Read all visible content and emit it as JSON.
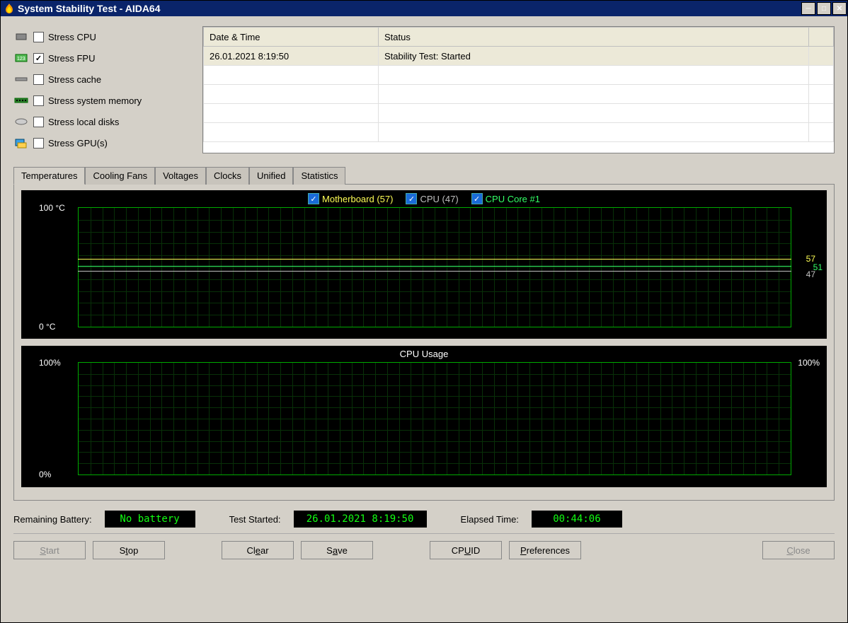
{
  "window": {
    "title": "System Stability Test - AIDA64"
  },
  "stress": {
    "items": [
      {
        "label": "Stress CPU",
        "checked": false
      },
      {
        "label": "Stress FPU",
        "checked": true
      },
      {
        "label": "Stress cache",
        "checked": false
      },
      {
        "label": "Stress system memory",
        "checked": false
      },
      {
        "label": "Stress local disks",
        "checked": false
      },
      {
        "label": "Stress GPU(s)",
        "checked": false
      }
    ]
  },
  "log": {
    "cols": [
      "Date & Time",
      "Status"
    ],
    "rows": [
      {
        "dt": "26.01.2021 8:19:50",
        "status": "Stability Test: Started"
      }
    ]
  },
  "tabs": [
    "Temperatures",
    "Cooling Fans",
    "Voltages",
    "Clocks",
    "Unified",
    "Statistics"
  ],
  "active_tab": 0,
  "chart_data": [
    {
      "type": "line",
      "title": "",
      "ylabel": "°C",
      "ylim": [
        0,
        100
      ],
      "y_ticks": [
        "100 °C",
        "0 °C"
      ],
      "legend": [
        {
          "name": "Motherboard (57)",
          "color": "#ffff55",
          "checked": true,
          "current": 57
        },
        {
          "name": "CPU (47)",
          "color": "#c0c0c0",
          "checked": true,
          "current": 47
        },
        {
          "name": "CPU Core #1",
          "color": "#33ff66",
          "checked": true,
          "current": 51
        }
      ],
      "series": [
        {
          "name": "Motherboard",
          "value_approx": 57
        },
        {
          "name": "CPU",
          "value_approx": 47
        },
        {
          "name": "CPU Core #1",
          "value_approx": 51
        }
      ],
      "right_labels": [
        "57",
        "51",
        "47"
      ]
    },
    {
      "type": "line",
      "title": "CPU Usage",
      "ylabel": "%",
      "ylim": [
        0,
        100
      ],
      "y_ticks_left": [
        "100%",
        "0%"
      ],
      "y_ticks_right": [
        "100%"
      ],
      "series": [
        {
          "name": "CPU Usage",
          "value_approx": 0
        }
      ]
    }
  ],
  "status": {
    "battery_label": "Remaining Battery:",
    "battery_value": "No battery",
    "started_label": "Test Started:",
    "started_value": "26.01.2021 8:19:50",
    "elapsed_label": "Elapsed Time:",
    "elapsed_value": "00:44:06"
  },
  "buttons": {
    "start": "Start",
    "stop": "Stop",
    "clear": "Clear",
    "save": "Save",
    "cpuid": "CPUID",
    "prefs": "Preferences",
    "close": "Close"
  }
}
